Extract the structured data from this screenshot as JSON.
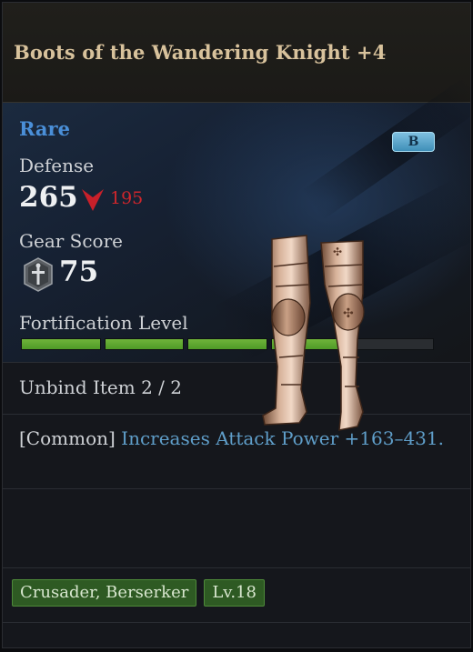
{
  "item": {
    "name": "Boots of the Wandering Knight +4",
    "rarity": "Rare",
    "grade": "B"
  },
  "stats": {
    "defense_label": "Defense",
    "defense_value": "265",
    "defense_diff": "195",
    "gear_score_label": "Gear Score",
    "gear_score_value": "75",
    "fortification_label": "Fortification Level",
    "fortification_filled": 4,
    "fortification_total": 5
  },
  "unbind": "Unbind Item 2 / 2",
  "effect": {
    "prefix": "[Common] ",
    "text": "Increases Attack Power +163–431."
  },
  "tags": {
    "classes": "Crusader, Berserker",
    "level": "Lv.18"
  },
  "colors": {
    "rarity": "#4a8fd8",
    "decrease": "#d0262c",
    "effect": "#5f9ec9",
    "bar_fill": "#5aa62f"
  },
  "icons": {
    "decrease": "down-arrow-icon",
    "gear_score": "sword-shield-icon"
  }
}
